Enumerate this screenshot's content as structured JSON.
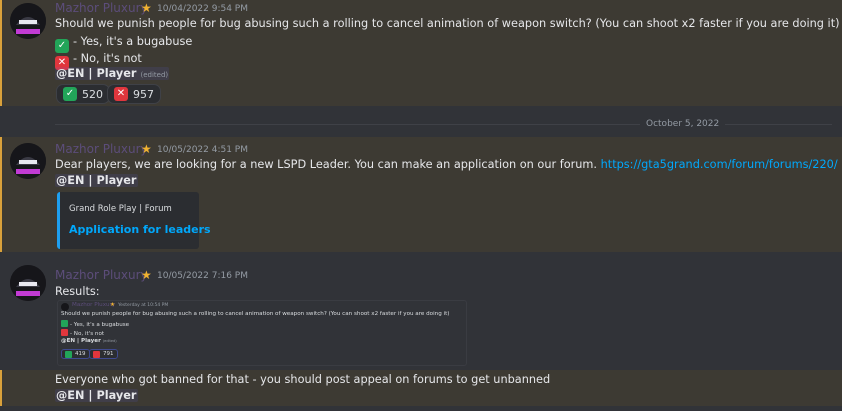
{
  "messages": [
    {
      "author": "Mazhor Pluxury",
      "timestamp": "10/04/2022 9:54 PM",
      "text": "Should we punish people for bug abusing such a rolling to cancel animation of weapon switch? (You can shoot x2 faster if you are doing it)",
      "options": [
        {
          "emoji": "check-icon",
          "label": "- Yes, it's a bugabuse"
        },
        {
          "emoji": "cross-icon",
          "label": "- No, it's not"
        }
      ],
      "mention": "@EN | Player",
      "edited": "(edited)",
      "reactions": [
        {
          "emoji": "check-icon",
          "count": "520"
        },
        {
          "emoji": "cross-icon",
          "count": "957"
        }
      ]
    },
    {
      "author": "Mazhor Pluxury",
      "timestamp": "10/05/2022 4:51 PM",
      "text": "Dear players, we are looking for a new LSPD Leader. You can make an application on our forum.",
      "link": "https://gta5grand.com/forum/forums/220/",
      "mention": "@EN | Player",
      "embed": {
        "provider": "Grand Role Play | Forum",
        "title": "Application for leaders"
      }
    },
    {
      "author": "Mazhor Pluxury",
      "timestamp": "10/05/2022 7:16 PM",
      "text": "Results:",
      "screenshot": {
        "author": "Mazhor Pluxury",
        "timestamp": "Yesterday at 10:54 PM",
        "text": "Should we punish people for bug abusing such a rolling to cancel animation of weapon switch? (You can shoot x2 faster if you are doing it)",
        "option_yes": "- Yes, it's a bugabuse",
        "option_no": "- No, it's not",
        "mention": "@EN | Player",
        "edited": "(edited)",
        "count_yes": "419",
        "count_no": "791"
      }
    },
    {
      "text": "Everyone who got banned for that - you should post appeal on forums to get unbanned",
      "mention": "@EN | Player"
    }
  ],
  "date_divider": "October 5, 2022",
  "colors": {
    "mention_highlight": "#3d3a33",
    "mention_bar": "#d9a13b",
    "link": "#00a8fc",
    "check": "#22a559",
    "cross": "#e0363d"
  }
}
